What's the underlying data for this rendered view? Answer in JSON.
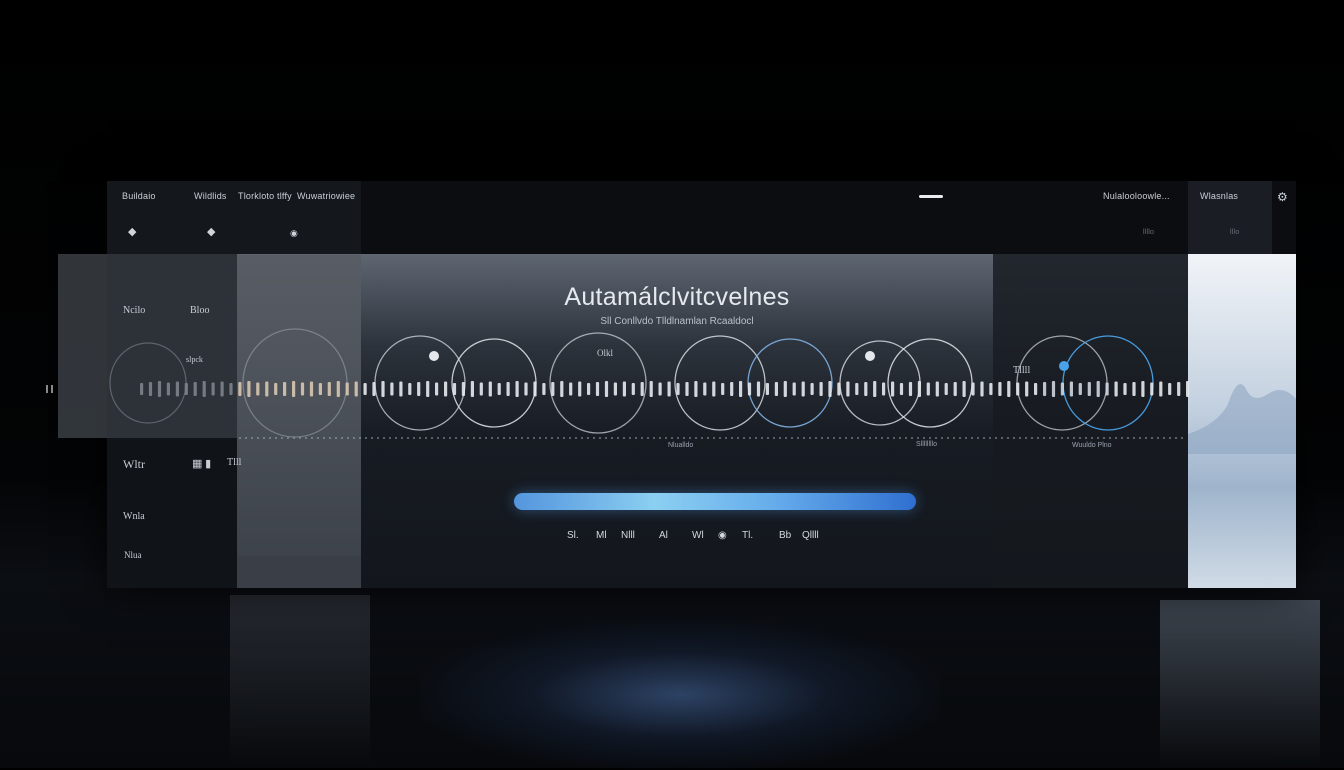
{
  "colors": {
    "accent": "#4aa3ea",
    "accent_light": "#7cc9f0",
    "background": "#000000",
    "panel": "#13171d"
  },
  "topbar": {
    "left_items": [
      "Buildaio",
      "Wildlids",
      "Tlorkloto tlffy",
      "Wuwatriowiee"
    ],
    "left_icons": [
      "shield-icon",
      "shield-icon",
      "record-icon"
    ],
    "right_text": "Nulalooloowle...",
    "right_item": "Wlasnlas",
    "right_icon": "gear-icon",
    "right_small_1": "llllo",
    "right_small_2": "lllo"
  },
  "main": {
    "title": "Autamálclvitcvelnes",
    "subtitle": "Sll Conllvdo Tlldlnamlan Rcaaldocl",
    "progress": 1.0
  },
  "left_panel": {
    "labels": [
      "Ncilo",
      "Bloo",
      "slpck",
      "Wltr",
      "Wnla"
    ],
    "footer": "Nlua",
    "icon_text": "Tlll"
  },
  "wave_labels": {
    "label_1": "Olkl",
    "label_2": "Tllll",
    "sublabel_1": "Nlualldo",
    "sublabel_2": "Sllllllllo",
    "sublabel_3": "Wuuldo Plno"
  },
  "controls": [
    "Sl.",
    "Ml",
    "Nlll",
    "Al",
    "Wl",
    "Tl.",
    "Bb",
    "Qllll"
  ],
  "waveform": {
    "bars": 118,
    "circles": 11
  }
}
